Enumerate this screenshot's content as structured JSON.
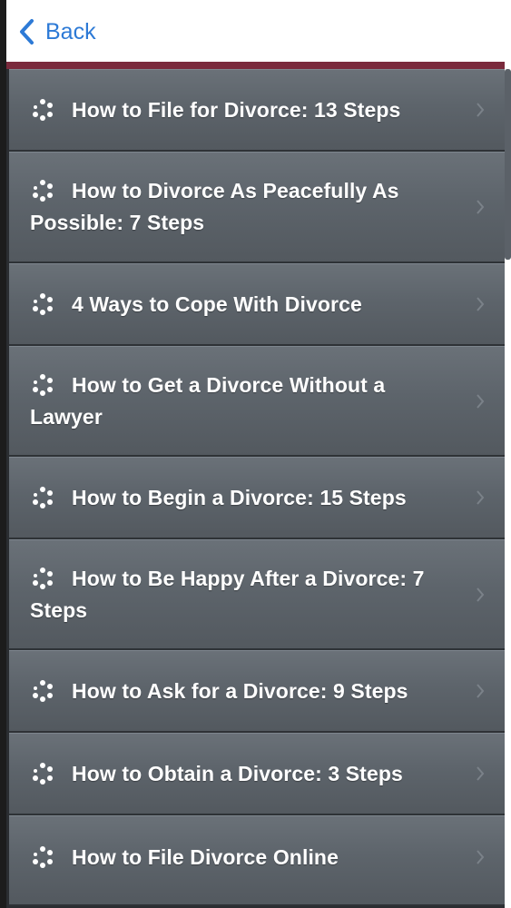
{
  "navbar": {
    "back_label": "Back"
  },
  "colors": {
    "accent": "#7a2a3c",
    "link": "#2d7ad6",
    "item_bg": "#5d646b",
    "item_text": "#ffffff"
  },
  "icons": {
    "list_item": "spinner-dots-icon",
    "back": "chevron-left-icon",
    "disclosure": "chevron-right-icon"
  },
  "list": {
    "items": [
      {
        "label": "How to File for Divorce: 13 Steps"
      },
      {
        "label": "How to Divorce As Peacefully As Possible: 7 Steps"
      },
      {
        "label": "4 Ways to Cope With Divorce"
      },
      {
        "label": "How to Get a Divorce Without a Lawyer"
      },
      {
        "label": "How to Begin a Divorce: 15 Steps"
      },
      {
        "label": "How to Be Happy After a Divorce: 7 Steps"
      },
      {
        "label": "How to Ask for a Divorce: 9 Steps"
      },
      {
        "label": "How to Obtain a Divorce: 3 Steps"
      },
      {
        "label": "How to File Divorce Online"
      }
    ]
  }
}
